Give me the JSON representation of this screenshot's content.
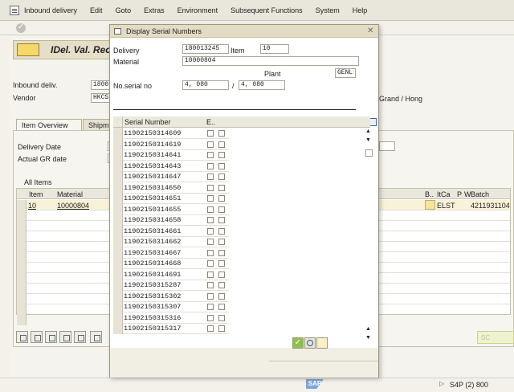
{
  "menu": {
    "items": [
      "Inbound delivery",
      "Edit",
      "Goto",
      "Extras",
      "Environment",
      "Subsequent Functions",
      "System",
      "Help"
    ]
  },
  "background": {
    "screen_title": "IDel. Val. Rec",
    "inbound_deliv_label": "Inbound deliv.",
    "inbound_deliv_value": "1800",
    "vendor_label": "Vendor",
    "vendor_value": "HKCS",
    "vendor_trailing": "Grand / Hong",
    "tabs": [
      "Item Overview",
      "Shipme"
    ],
    "delivery_date_label": "Delivery Date",
    "actual_gr_date_label": "Actual GR date",
    "all_items_label": "All Items",
    "columns": [
      "Item",
      "Material",
      "B..",
      "ItCa",
      "P",
      "W",
      "Batch"
    ],
    "row": {
      "item": "10",
      "material": "10000804",
      "itca": "ELST",
      "batch": "4211931104"
    },
    "right_button": "SC"
  },
  "dialog": {
    "title": "Display Serial Numbers",
    "delivery_label": "Delivery",
    "delivery_value": "180013245",
    "item_label": "Item",
    "item_value": "10",
    "material_label": "Material",
    "material_value": "10000804",
    "plant_label": "Plant",
    "plant_value": "GENL",
    "no_serial_label": "No.serial no",
    "no_serial_value": "4, 080",
    "no_serial_sep": "/",
    "no_serial_total": "4, 080",
    "grid_headers": [
      "Serial Number",
      "E.."
    ],
    "serials": [
      "11902150314609",
      "11902150314619",
      "11902150314641",
      "11902150314643",
      "11902150314647",
      "11902150314650",
      "11902150314651",
      "11902150314655",
      "11902150314658",
      "11902150314661",
      "11902150314662",
      "11902150314667",
      "11902150314668",
      "11902150314691",
      "11902150315287",
      "11902150315302",
      "11902150315307",
      "11902150315316",
      "11902150315317"
    ]
  },
  "status": {
    "system": "S4P (2) 800"
  },
  "icons": {
    "logo": "sap-logo",
    "menu": "menu-icon",
    "ok": "check-icon",
    "details": "details-icon"
  }
}
